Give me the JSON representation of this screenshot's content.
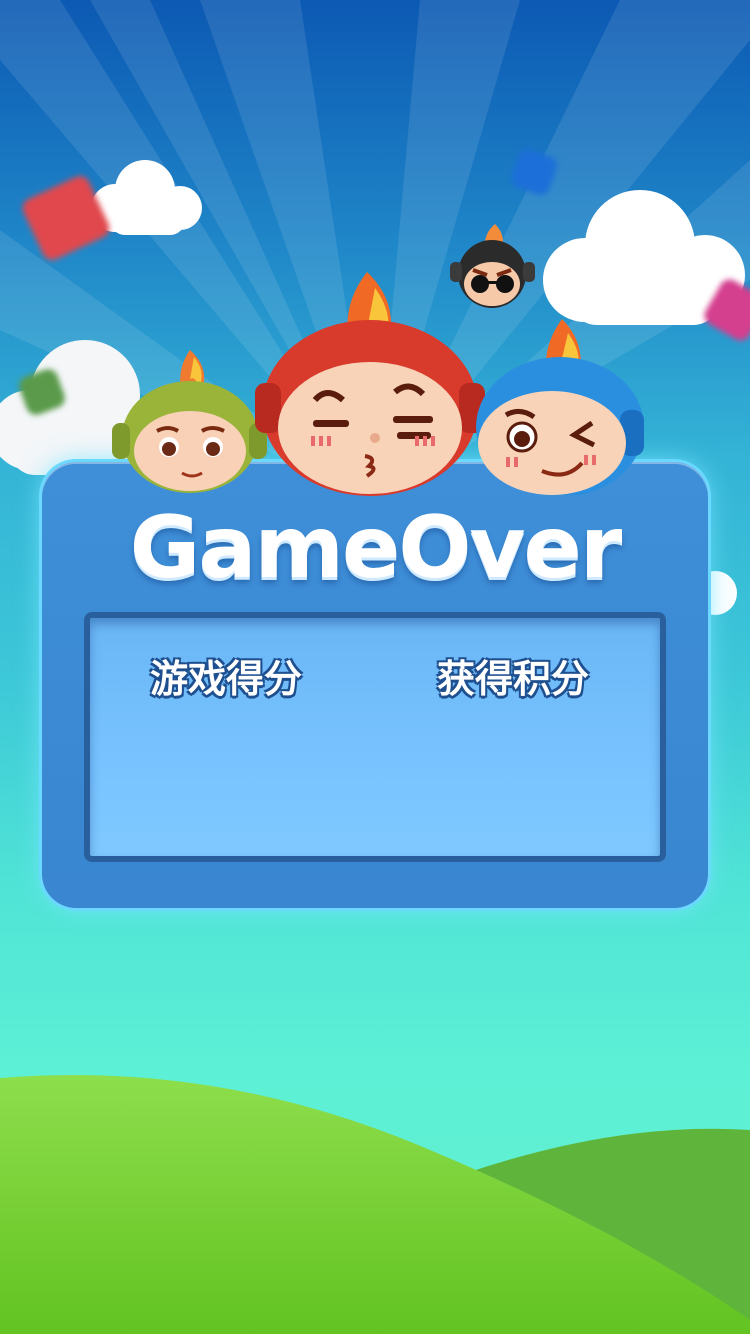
{
  "screen": "game-over",
  "title": "GameOver",
  "labels": {
    "game_score": "游戏得分",
    "earned_points": "获得积分"
  },
  "values": {
    "game_score": "",
    "earned_points": ""
  },
  "colors": {
    "sky_top": "#0c59b3",
    "sky_bottom": "#66f0cf",
    "panel": "#3e8fd8",
    "score_box": "#78c3ff",
    "hill": "#6dce2f"
  }
}
